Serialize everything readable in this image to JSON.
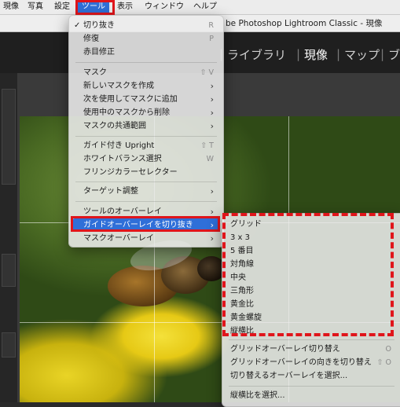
{
  "menubar": {
    "items": [
      "現像",
      "写真",
      "設定",
      "ツール",
      "表示",
      "ウィンドウ",
      "ヘルプ"
    ],
    "selected_index": 3
  },
  "window": {
    "title": "be Photoshop Lightroom Classic - 現像"
  },
  "modules": {
    "items": [
      "ライブラリ",
      "現像",
      "マップ",
      "ブ"
    ],
    "separator": "|",
    "active_index": 1
  },
  "tools_menu": {
    "items": [
      {
        "label": "切り抜き",
        "shortcut": "R",
        "checked": true
      },
      {
        "label": "修復",
        "shortcut": "P"
      },
      {
        "label": "赤目修正",
        "shortcut": ""
      },
      {
        "label": "マスク",
        "shortcut": "⇧ V"
      },
      {
        "label": "新しいマスクを作成",
        "submenu": true
      },
      {
        "label": "次を使用してマスクに追加",
        "submenu": true
      },
      {
        "label": "使用中のマスクから削除",
        "submenu": true
      },
      {
        "label": "マスクの共通範囲",
        "submenu": true
      },
      {
        "label": "ガイド付き Upright",
        "shortcut": "⇧ T"
      },
      {
        "label": "ホワイトバランス選択",
        "shortcut": "W"
      },
      {
        "label": "フリンジカラーセレクター",
        "shortcut": ""
      },
      {
        "label": "ターゲット調整",
        "submenu": true
      },
      {
        "label": "ツールのオーバーレイ",
        "submenu": true
      },
      {
        "label": "ガイドオーバーレイを切り抜き",
        "submenu": true,
        "highlighted": true
      },
      {
        "label": "マスクオーバーレイ",
        "submenu": true
      }
    ],
    "submenu_arrow": "›",
    "check_mark": "✓"
  },
  "overlay_submenu": {
    "items": [
      {
        "label": "グリッド"
      },
      {
        "label": "3 x 3"
      },
      {
        "label": "5 番目"
      },
      {
        "label": "対角線"
      },
      {
        "label": "中央"
      },
      {
        "label": "三角形"
      },
      {
        "label": "黄金比"
      },
      {
        "label": "黄金螺旋"
      },
      {
        "label": "縦横比"
      },
      {
        "label": "グリッドオーバーレイ切り替え",
        "shortcut": "O"
      },
      {
        "label": "グリッドオーバーレイの向きを切り替え",
        "shortcut": "⇧ O"
      },
      {
        "label": "切り替えるオーバーレイを選択..."
      },
      {
        "label": "縦横比を選択..."
      }
    ]
  },
  "colors": {
    "highlight": "#2f6fd8",
    "annotation_red": "#e0151b"
  }
}
